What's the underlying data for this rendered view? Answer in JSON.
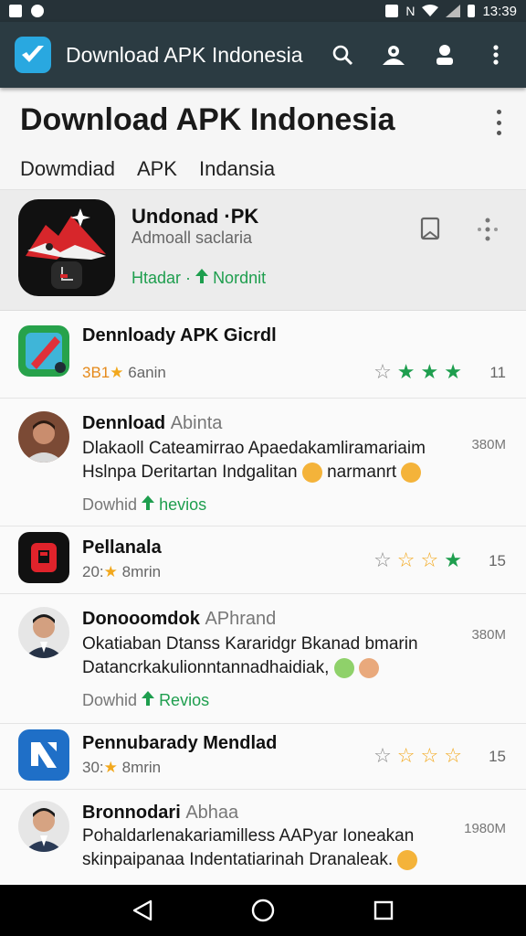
{
  "status_bar": {
    "time": "13:39"
  },
  "app_bar": {
    "title": "Download APK Indonesia",
    "logo_icon": "download-logo-icon",
    "actions": [
      "search-icon",
      "account-icon",
      "person-icon",
      "more-vert-icon"
    ]
  },
  "header": {
    "title": "Download APK Indonesia",
    "chips": [
      "Dowmdiad",
      "APK",
      "Indansia"
    ]
  },
  "featured": {
    "title": "Undonad ·PK",
    "subtitle": "Admoall saclaria",
    "meta_left": "Htadar ·",
    "meta_right": "Nordnit"
  },
  "items": [
    {
      "title": "Dennloady APK Gicrdl",
      "meta_num": "3B1",
      "meta_text": "6anin",
      "stars": "11"
    },
    {
      "title": "Dennload",
      "dev": "Abinta",
      "line1": "Dlakaoll Cateamirrao Apaedakamliramariaim",
      "line2": "Hslnpa Deritartan Indgalitan",
      "line2b": "narmanrt",
      "size": "380M",
      "rev_left": "Dowhid",
      "rev_right": "hevios"
    },
    {
      "title": "Pellanala",
      "meta_num": "20:",
      "meta_text": "8mrin",
      "stars": "15"
    },
    {
      "title": "Donooomdok",
      "dev": "APhrand",
      "line1": "Okatiaban Dtanss Kararidgr Bkanad bmarin",
      "line2": "Datancrkakulionntannadhaidiak,",
      "size": "380M",
      "rev_left": "Dowhid",
      "rev_right": "Revios"
    },
    {
      "title": "Pennubarady Mendlad",
      "meta_num": "30:",
      "meta_text": "8mrin",
      "stars": "15"
    },
    {
      "title": "Bronnodari",
      "dev": "Abhaa",
      "line1": "Pohaldarlenakariamilless AAPyar Ioneakan",
      "line2": "skinpaipanaa Indentatiarinah Dranaleak.",
      "size": "1980M"
    }
  ],
  "colors": {
    "app_bar": "#2b3b42",
    "accent_green": "#1e9e4e",
    "star_yellow": "#f2a81d"
  }
}
